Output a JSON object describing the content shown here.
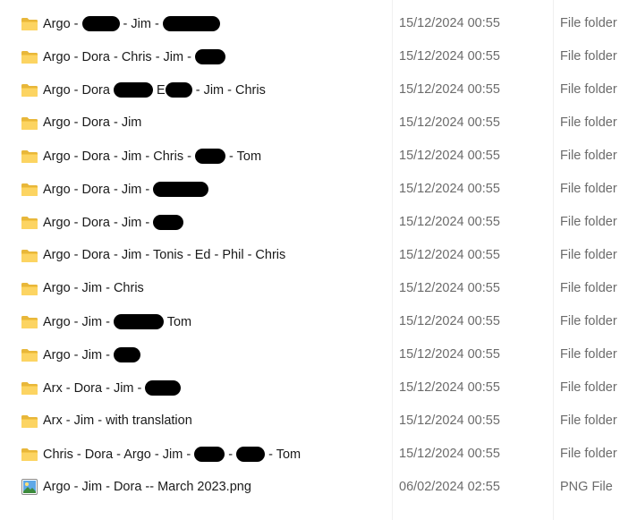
{
  "files": [
    {
      "segments": [
        "Argo - ",
        null,
        " - Jim - ",
        null
      ],
      "date": "15/12/2024 00:55",
      "type": "File folder",
      "icon": "folder-icon"
    },
    {
      "segments": [
        "Argo - Dora - Chris - Jim - ",
        null
      ],
      "date": "15/12/2024 00:55",
      "type": "File folder",
      "icon": "folder-icon"
    },
    {
      "segments": [
        "Argo - Dora ",
        null,
        " E",
        null,
        " - Jim - Chris"
      ],
      "date": "15/12/2024 00:55",
      "type": "File folder",
      "icon": "folder-icon"
    },
    {
      "segments": [
        "Argo - Dora - Jim"
      ],
      "date": "15/12/2024 00:55",
      "type": "File folder",
      "icon": "folder-icon"
    },
    {
      "segments": [
        "Argo - Dora - Jim - Chris - ",
        null,
        " - Tom"
      ],
      "date": "15/12/2024 00:55",
      "type": "File folder",
      "icon": "folder-icon"
    },
    {
      "segments": [
        "Argo - Dora - Jim - ",
        null
      ],
      "date": "15/12/2024 00:55",
      "type": "File folder",
      "icon": "folder-icon"
    },
    {
      "segments": [
        "Argo - Dora - Jim - ",
        null
      ],
      "date": "15/12/2024 00:55",
      "type": "File folder",
      "icon": "folder-icon"
    },
    {
      "segments": [
        "Argo - Dora - Jim - Tonis - Ed - Phil - Chris"
      ],
      "date": "15/12/2024 00:55",
      "type": "File folder",
      "icon": "folder-icon"
    },
    {
      "segments": [
        "Argo - Jim - Chris"
      ],
      "date": "15/12/2024 00:55",
      "type": "File folder",
      "icon": "folder-icon"
    },
    {
      "segments": [
        "Argo - Jim - ",
        null,
        " Tom"
      ],
      "date": "15/12/2024 00:55",
      "type": "File folder",
      "icon": "folder-icon"
    },
    {
      "segments": [
        "Argo - Jim - ",
        null
      ],
      "date": "15/12/2024 00:55",
      "type": "File folder",
      "icon": "folder-icon"
    },
    {
      "segments": [
        "Arx - Dora - Jim - ",
        null
      ],
      "date": "15/12/2024 00:55",
      "type": "File folder",
      "icon": "folder-icon"
    },
    {
      "segments": [
        "Arx - Jim - with translation"
      ],
      "date": "15/12/2024 00:55",
      "type": "File folder",
      "icon": "folder-icon"
    },
    {
      "segments": [
        "Chris - Dora - Argo - Jim - ",
        null,
        " - ",
        null,
        " - Tom"
      ],
      "date": "15/12/2024 00:55",
      "type": "File folder",
      "icon": "folder-icon"
    },
    {
      "segments": [
        "Argo - Jim - Dora -- March 2023.png"
      ],
      "date": "06/02/2024 02:55",
      "type": "PNG File",
      "icon": "png-image-icon"
    }
  ]
}
